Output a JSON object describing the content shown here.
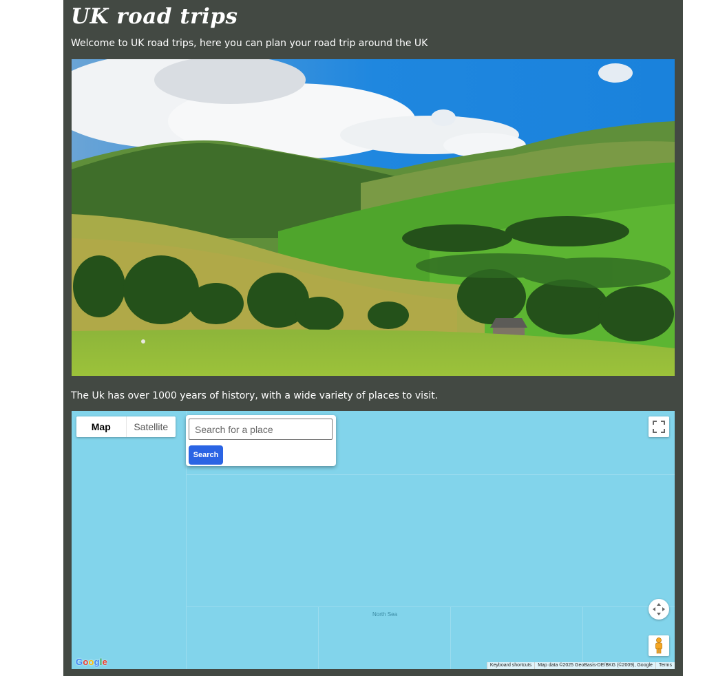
{
  "header": {
    "title": "UK road trips",
    "intro": "Welcome to UK road trips, here you can plan your road trip around the UK"
  },
  "content": {
    "history": "The Uk has over 1000 years of history, with a wide variety of places to visit."
  },
  "map": {
    "type_control": {
      "map_label": "Map",
      "satellite_label": "Satellite"
    },
    "search": {
      "placeholder": "Search for a place",
      "button_label": "Search"
    },
    "sea_label": "North Sea",
    "logo": [
      "G",
      "o",
      "o",
      "g",
      "l",
      "e"
    ],
    "logo_colors": [
      "#4285f4",
      "#ea4335",
      "#fbbc05",
      "#4285f4",
      "#34a853",
      "#ea4335"
    ],
    "attribution": {
      "shortcuts": "Keyboard shortcuts",
      "map_data": "Map data ©2025 GeoBasis-DE/BKG (©2009), Google",
      "terms": "Terms"
    },
    "icons": [
      "fullscreen-icon",
      "camera-control-icon",
      "pegman-icon"
    ],
    "water_color": "#82d4eb",
    "search_button_color": "#2a64e4"
  },
  "colors": {
    "page_background": "#434943",
    "text": "#ffffff"
  }
}
